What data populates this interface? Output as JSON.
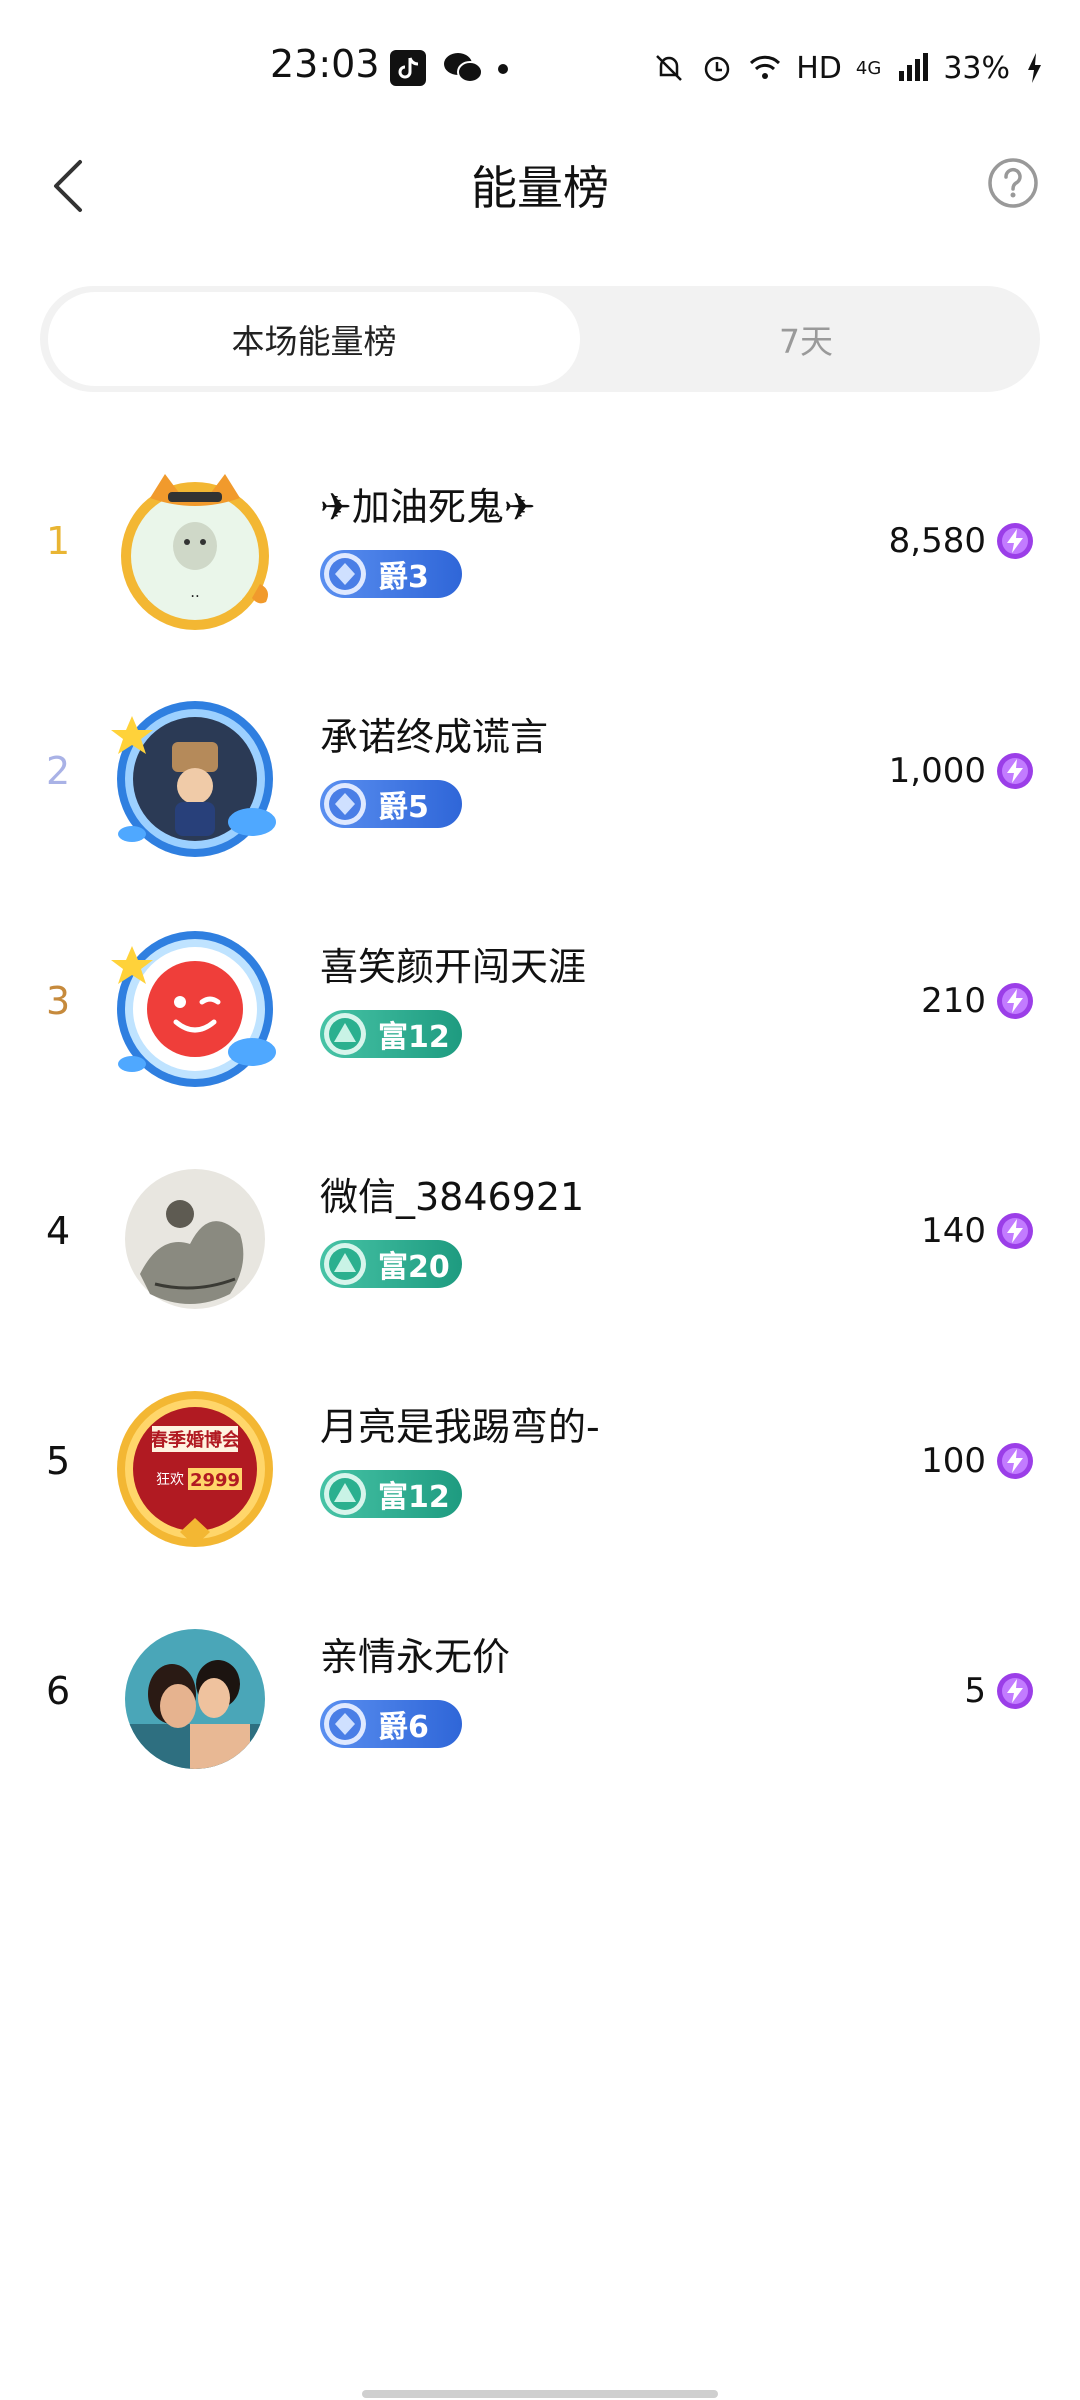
{
  "status_bar": {
    "time": "23:03",
    "network": "HD",
    "network_gen": "4G",
    "battery": "33%"
  },
  "header": {
    "title": "能量榜"
  },
  "tabs": [
    {
      "label": "本场能量榜",
      "active": true
    },
    {
      "label": "7天",
      "active": false
    }
  ],
  "colors": {
    "rank1": "#e9b533",
    "rank2": "#a9b2e6",
    "rank3": "#c68a3c",
    "rank_default": "#111111",
    "jue_badge": "#3a73e0",
    "fu_badge": "#28a888",
    "energy_icon": "#9b3ee8"
  },
  "ranking": [
    {
      "rank": "1",
      "name": "✈加油死鬼✈",
      "badge_label": "爵3",
      "badge_type": "jue",
      "score": "8,580",
      "avatar": "tiger-frame-dog-avatar"
    },
    {
      "rank": "2",
      "name": "承诺终成谎言",
      "badge_label": "爵5",
      "badge_type": "jue",
      "score": "1,000",
      "avatar": "blue-frame-child-avatar"
    },
    {
      "rank": "3",
      "name": "喜笑颜开闯天涯",
      "badge_label": "富12",
      "badge_type": "fu",
      "score": "210",
      "avatar": "blue-frame-wink-avatar"
    },
    {
      "rank": "4",
      "name": "微信_3846921",
      "badge_label": "富20",
      "badge_type": "fu",
      "score": "140",
      "avatar": "ink-painting-avatar"
    },
    {
      "rank": "5",
      "name": "月亮是我踢弯的-",
      "badge_label": "富12",
      "badge_type": "fu",
      "score": "100",
      "avatar": "gold-frame-wedding-expo-avatar",
      "avatar_text": {
        "title": "春季婚博会",
        "promo": "狂欢",
        "price": "2999"
      }
    },
    {
      "rank": "6",
      "name": "亲情永无价",
      "badge_label": "爵6",
      "badge_type": "jue",
      "score": "5",
      "avatar": "couple-photo-avatar"
    }
  ]
}
